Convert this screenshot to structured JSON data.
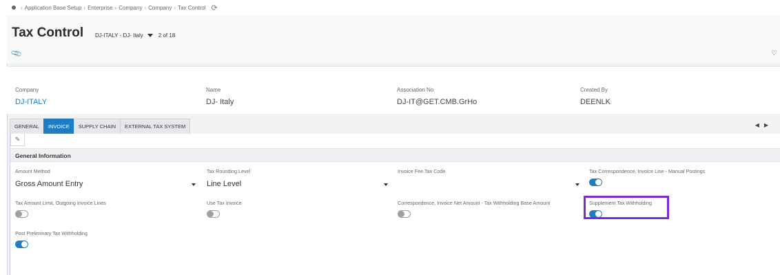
{
  "breadcrumb": {
    "items": [
      "Application Base Setup",
      "Enterprise",
      "Company",
      "Company",
      "Tax Control"
    ]
  },
  "header": {
    "title": "Tax Control",
    "record": "DJ-ITALY - DJ- Italy",
    "position": "2 of 18"
  },
  "record_fields": [
    {
      "label": "Company",
      "value": "DJ-ITALY"
    },
    {
      "label": "Name",
      "value": "DJ- Italy"
    },
    {
      "label": "Association No",
      "value": "DJ-IT@GET.CMB.GrHo"
    },
    {
      "label": "Created By",
      "value": "DEENLK"
    }
  ],
  "tabs": [
    "GENERAL",
    "INVOICE",
    "SUPPLY CHAIN",
    "EXTERNAL TAX SYSTEM"
  ],
  "active_tab": "INVOICE",
  "section": {
    "title": "General Information"
  },
  "fields": {
    "amount_method": {
      "label": "Amount Method",
      "value": "Gross Amount Entry"
    },
    "tax_rounding_level": {
      "label": "Tax Rounding Level",
      "value": "Line Level"
    },
    "invoice_fee_tax_code": {
      "label": "Invoice Fee Tax Code",
      "value": ""
    },
    "tax_corr_manual": {
      "label": "Tax Correspondence, Invoice Line - Manual Postings",
      "on": true
    },
    "tax_amount_limit": {
      "label": "Tax Amount Limit, Outgoing Invoice Lines",
      "on": false
    },
    "use_tax_invoice": {
      "label": "Use Tax Invoice",
      "on": false
    },
    "corr_net_amount": {
      "label": "Correspondence, Invoice Net Amount - Tax Withholding Base Amount",
      "on": false
    },
    "supplement_tax_withholding": {
      "label": "Supplement Tax Withholding",
      "on": true
    },
    "post_preliminary": {
      "label": "Post Preliminary Tax Withholding",
      "on": true
    }
  },
  "colors": {
    "accent": "#1f7ec3",
    "highlight": "#7b2bd2"
  }
}
